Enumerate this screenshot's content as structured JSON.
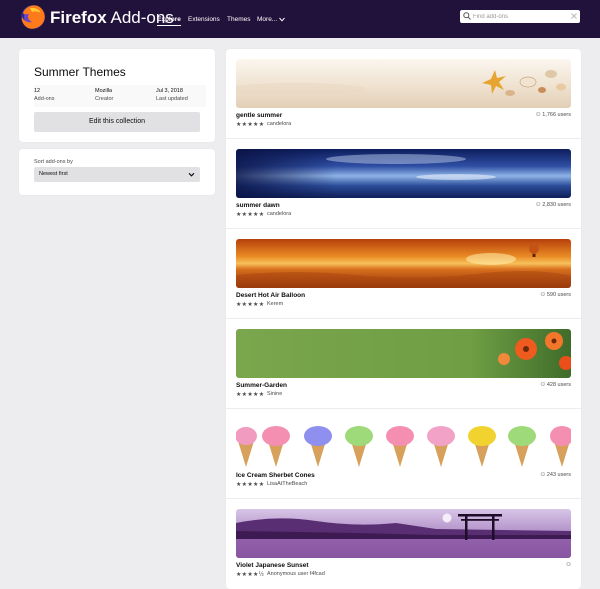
{
  "header": {
    "brand_word": "Firefox",
    "brand_suffix": "Add-ons",
    "nav": [
      "Explore",
      "Extensions",
      "Themes",
      "More..."
    ],
    "search_placeholder": "Find add-ons"
  },
  "collection": {
    "title": "Summer Themes",
    "meta": [
      {
        "value": "12",
        "label": "Add-ons"
      },
      {
        "value": "Mozilla",
        "label": "Creator"
      },
      {
        "value": "Jul 3, 2018",
        "label": "Last updated"
      }
    ],
    "edit_label": "Edit this collection"
  },
  "sort": {
    "label": "Sort add-ons by",
    "value": "Newest first"
  },
  "addons": [
    {
      "name": "gentle summer",
      "rating": "★★★★★",
      "author": "candelora",
      "users": "1,766 users",
      "stars": 5
    },
    {
      "name": "summer dawn",
      "rating": "★★★★★",
      "author": "candelora",
      "users": "2,830 users",
      "stars": 5
    },
    {
      "name": "Desert Hot Air Balloon",
      "rating": "★★★★★",
      "author": "Kerem",
      "users": "590 users",
      "stars": 5
    },
    {
      "name": "Summer-Garden",
      "rating": "★★★★★",
      "author": "Sinine",
      "users": "428 users",
      "stars": 5
    },
    {
      "name": "Ice Cream Sherbet Cones",
      "rating": "★★★★★",
      "author": "LisaAtTheBeach",
      "users": "243 users",
      "stars": 5
    },
    {
      "name": "Violet Japanese Sunset",
      "rating": "★★★★½",
      "author": "Anonymous user f4fcad",
      "users": "",
      "stars": 4.5
    }
  ],
  "colors": {
    "header_bg": "#20123a",
    "page_bg": "#ededf0",
    "card_bg": "#ffffff"
  }
}
